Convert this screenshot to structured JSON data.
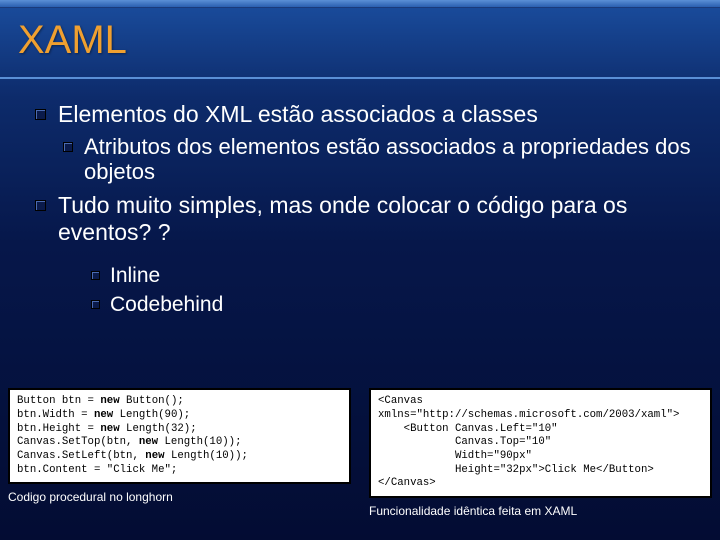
{
  "title": "XAML",
  "bullets": {
    "l1a": "Elementos do XML estão associados a classes",
    "l2a": "Atributos dos elementos estão associados a propriedades dos objetos",
    "l1b": "Tudo muito simples, mas onde colocar o código para os eventos? ?",
    "l3a": "Inline",
    "l3b": "Codebehind"
  },
  "code": {
    "left": {
      "l1a": "Button btn = ",
      "l1b": "new",
      "l1c": " Button();",
      "l2a": "btn.Width = ",
      "l2b": "new",
      "l2c": " Length(90);",
      "l3a": "btn.Height = ",
      "l3b": "new",
      "l3c": " Length(32);",
      "l4a": "Canvas.SetTop(btn, ",
      "l4b": "new",
      "l4c": " Length(10));",
      "l5a": "Canvas.SetLeft(btn, ",
      "l5b": "new",
      "l5c": " Length(10));",
      "l6": "btn.Content = \"Click Me\";"
    },
    "right": {
      "l1": "<Canvas",
      "l2": "xmlns=\"http://schemas.microsoft.com/2003/xaml\">",
      "l3": "    <Button Canvas.Left=\"10\"",
      "l4": "            Canvas.Top=\"10\"",
      "l5": "            Width=\"90px\"",
      "l6": "            Height=\"32px\">Click Me</Button>",
      "l7": "</Canvas>"
    }
  },
  "captions": {
    "left": "Codigo procedural no longhorn",
    "right": "Funcionalidade idêntica feita em XAML"
  }
}
